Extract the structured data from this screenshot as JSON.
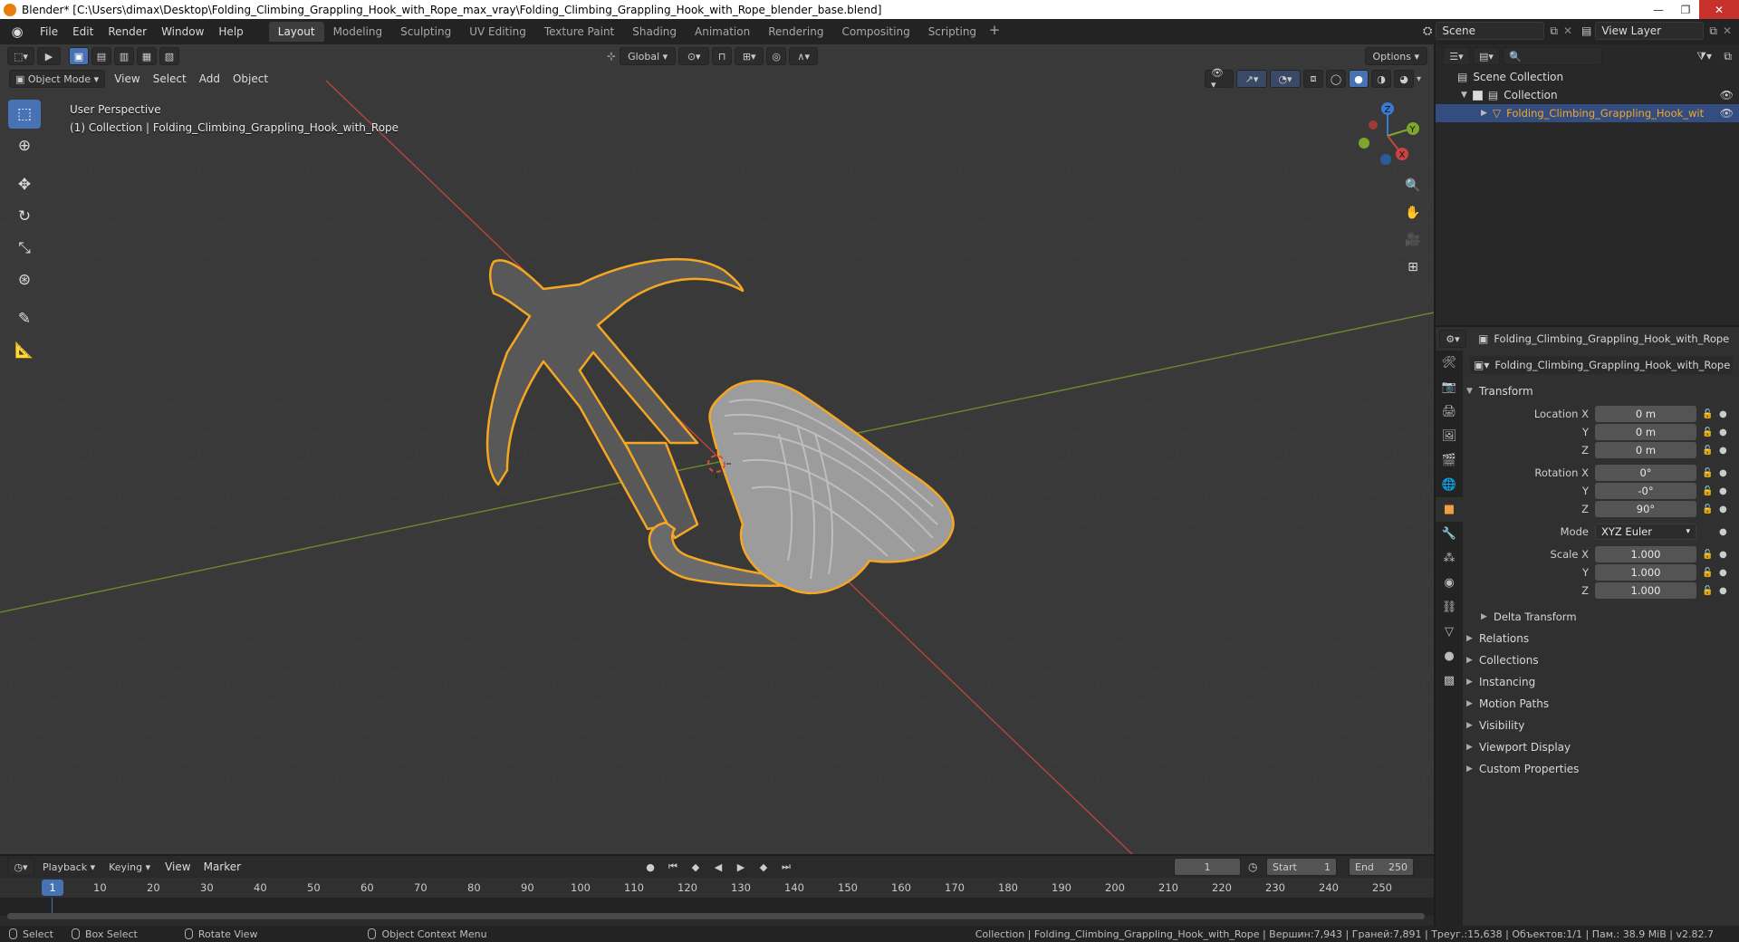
{
  "window": {
    "title": "Blender* [C:\\Users\\dimax\\Desktop\\Folding_Climbing_Grappling_Hook_with_Rope_max_vray\\Folding_Climbing_Grappling_Hook_with_Rope_blender_base.blend]",
    "controls": [
      "—",
      "❐",
      "✕"
    ]
  },
  "menubar": {
    "items": [
      "File",
      "Edit",
      "Render",
      "Window",
      "Help"
    ],
    "workspaces": [
      "Layout",
      "Modeling",
      "Sculpting",
      "UV Editing",
      "Texture Paint",
      "Shading",
      "Animation",
      "Rendering",
      "Compositing",
      "Scripting"
    ],
    "active_workspace": "Layout",
    "scene": "Scene",
    "view_layer": "View Layer"
  },
  "viewport": {
    "transform_orientation": "Global",
    "options_label": "Options",
    "mode": "Object Mode",
    "menus": [
      "View",
      "Select",
      "Add",
      "Object"
    ],
    "info_line1": "User Perspective",
    "info_line2": "(1) Collection | Folding_Climbing_Grappling_Hook_with_Rope",
    "gizmo_axes": [
      "X",
      "Y",
      "Z"
    ],
    "colors": {
      "x_axis": "#c8453f",
      "y_axis": "#7da62c",
      "z_axis": "#3a7ad4",
      "selection": "#f5a623",
      "background": "#393939",
      "grid": "#454545"
    },
    "tools": [
      "select-box",
      "cursor",
      "move",
      "rotate",
      "scale",
      "transform",
      "annotate",
      "measure"
    ]
  },
  "outliner": {
    "scene_collection": "Scene Collection",
    "collection": "Collection",
    "object": "Folding_Climbing_Grappling_Hook_with_Rope"
  },
  "properties": {
    "header_object": "Folding_Climbing_Grappling_Hook_with_Rope",
    "object_name": "Folding_Climbing_Grappling_Hook_with_Rope",
    "transform_label": "Transform",
    "location_label": "Location X",
    "rotation_label": "Rotation X",
    "scale_label": "Scale X",
    "mode_label": "Mode",
    "y_label": "Y",
    "z_label": "Z",
    "location": [
      "0 m",
      "0 m",
      "0 m"
    ],
    "rotation": [
      "0°",
      "-0°",
      "90°"
    ],
    "rotation_mode": "XYZ Euler",
    "scale": [
      "1.000",
      "1.000",
      "1.000"
    ],
    "delta_transform": "Delta Transform",
    "panels": [
      "Relations",
      "Collections",
      "Instancing",
      "Motion Paths",
      "Visibility",
      "Viewport Display",
      "Custom Properties"
    ]
  },
  "timeline": {
    "menus": [
      "Playback",
      "Keying",
      "View",
      "Marker"
    ],
    "current_frame": "1",
    "start_label": "Start",
    "start": "1",
    "end_label": "End",
    "end": "250",
    "ticks": [
      "10",
      "20",
      "30",
      "40",
      "50",
      "60",
      "70",
      "80",
      "90",
      "100",
      "110",
      "120",
      "130",
      "140",
      "150",
      "160",
      "170",
      "180",
      "190",
      "200",
      "210",
      "220",
      "230",
      "240",
      "250"
    ],
    "playhead_label": "1"
  },
  "statusbar": {
    "select": "Select",
    "box_select": "Box Select",
    "rotate_view": "Rotate View",
    "context_menu": "Object Context Menu",
    "stats": "Collection | Folding_Climbing_Grappling_Hook_with_Rope | Вершин:7,943 | Граней:7,891 | Треуг.:15,638 | Объектов:1/1 | Пам.: 38.9 MiB | v2.82.7"
  }
}
